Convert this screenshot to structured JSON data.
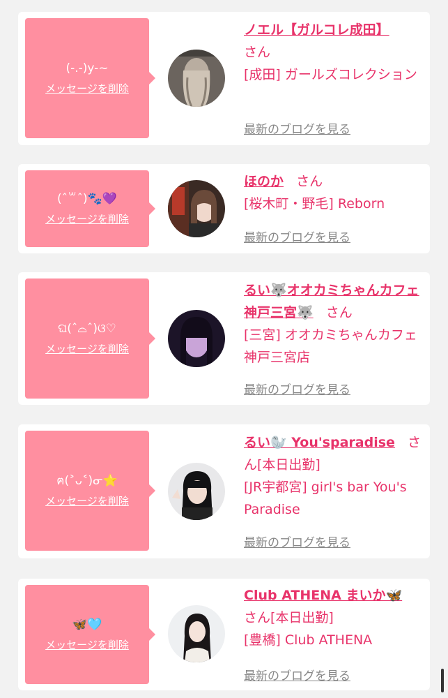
{
  "delete_label": "メッセージを削除",
  "blog_label": "最新のブログを見る",
  "cards": [
    {
      "message": "(-.-)y-~",
      "name": "ノエル【ガルコレ成田】",
      "san": "さん",
      "shop": "[成田] ガールズコレクション"
    },
    {
      "message": "(ˆ꒳ˆ)🐾💜",
      "name": "ほのか",
      "san": "さん",
      "shop": "[桜木町・野毛] Reborn"
    },
    {
      "message": "ଘ(ˆ⌓ˆ)ଓ♡",
      "name": "るい🐺オオカミちゃんカフェ神戸三宮🐺",
      "san": "さん",
      "shop": "[三宮] オオカミちゃんカフェ神戸三宮店"
    },
    {
      "message": "ฅ(˃ᴗ˂)ᓂ⭐",
      "name": "るい🦭 You'sparadise",
      "san": "さん[本日出勤]",
      "shop": "[JR宇都宮] girl's bar You's Paradise"
    },
    {
      "message": "🦋🩵",
      "name": "Club ATHENA まいか🦋",
      "san": "さん[本日出勤]",
      "shop": "[豊橋] Club ATHENA"
    }
  ],
  "colors": {
    "accent": "#e8336a",
    "bubble": "#ff8fa0",
    "background": "#f2f2f2"
  }
}
